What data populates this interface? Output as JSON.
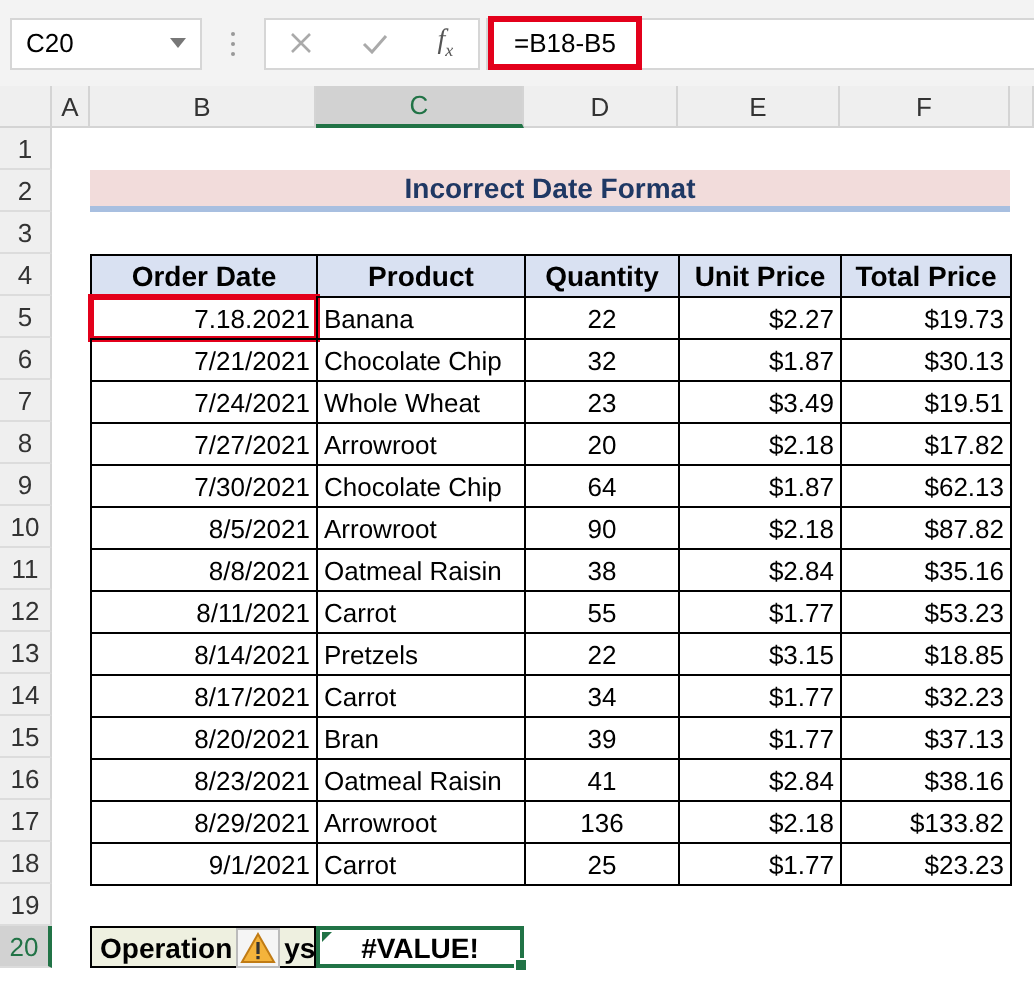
{
  "formula_bar": {
    "name_box": "C20",
    "function_button": "f$_{x}$",
    "formula": "=B18-B5",
    "formula_highlighted": true
  },
  "column_headers": [
    {
      "label": "A",
      "selected": false
    },
    {
      "label": "B",
      "selected": false
    },
    {
      "label": "C",
      "selected": true
    },
    {
      "label": "D",
      "selected": false
    },
    {
      "label": "E",
      "selected": false
    },
    {
      "label": "F",
      "selected": false
    }
  ],
  "row_headers": [
    {
      "label": "1",
      "selected": false
    },
    {
      "label": "2",
      "selected": false
    },
    {
      "label": "3",
      "selected": false
    },
    {
      "label": "4",
      "selected": false
    },
    {
      "label": "5",
      "selected": false
    },
    {
      "label": "6",
      "selected": false
    },
    {
      "label": "7",
      "selected": false
    },
    {
      "label": "8",
      "selected": false
    },
    {
      "label": "9",
      "selected": false
    },
    {
      "label": "10",
      "selected": false
    },
    {
      "label": "11",
      "selected": false
    },
    {
      "label": "12",
      "selected": false
    },
    {
      "label": "13",
      "selected": false
    },
    {
      "label": "14",
      "selected": false
    },
    {
      "label": "15",
      "selected": false
    },
    {
      "label": "16",
      "selected": false
    },
    {
      "label": "17",
      "selected": false
    },
    {
      "label": "18",
      "selected": false
    },
    {
      "label": "19",
      "selected": false
    },
    {
      "label": "20",
      "selected": true
    }
  ],
  "title": "Incorrect Date Format",
  "table": {
    "columns": [
      "Order Date",
      "Product",
      "Quantity",
      "Unit Price",
      "Total Price"
    ],
    "rows": [
      {
        "cells": [
          "7.18.2021",
          "Banana",
          "22",
          "$2.27",
          "$19.73"
        ],
        "date_highlighted": true
      },
      {
        "cells": [
          "7/21/2021",
          "Chocolate Chip",
          "32",
          "$1.87",
          "$30.13"
        ],
        "date_highlighted": false
      },
      {
        "cells": [
          "7/24/2021",
          "Whole Wheat",
          "23",
          "$3.49",
          "$19.51"
        ],
        "date_highlighted": false
      },
      {
        "cells": [
          "7/27/2021",
          "Arrowroot",
          "20",
          "$2.18",
          "$17.82"
        ],
        "date_highlighted": false
      },
      {
        "cells": [
          "7/30/2021",
          "Chocolate Chip",
          "64",
          "$1.87",
          "$62.13"
        ],
        "date_highlighted": false
      },
      {
        "cells": [
          "8/5/2021",
          "Arrowroot",
          "90",
          "$2.18",
          "$87.82"
        ],
        "date_highlighted": false
      },
      {
        "cells": [
          "8/8/2021",
          "Oatmeal Raisin",
          "38",
          "$2.84",
          "$35.16"
        ],
        "date_highlighted": false
      },
      {
        "cells": [
          "8/11/2021",
          "Carrot",
          "55",
          "$1.77",
          "$53.23"
        ],
        "date_highlighted": false
      },
      {
        "cells": [
          "8/14/2021",
          "Pretzels",
          "22",
          "$3.15",
          "$18.85"
        ],
        "date_highlighted": false
      },
      {
        "cells": [
          "8/17/2021",
          "Carrot",
          "34",
          "$1.77",
          "$32.23"
        ],
        "date_highlighted": false
      },
      {
        "cells": [
          "8/20/2021",
          "Bran",
          "39",
          "$1.77",
          "$37.13"
        ],
        "date_highlighted": false
      },
      {
        "cells": [
          "8/23/2021",
          "Oatmeal Raisin",
          "41",
          "$2.84",
          "$38.16"
        ],
        "date_highlighted": false
      },
      {
        "cells": [
          "8/29/2021",
          "Arrowroot",
          "136",
          "$2.18",
          "$133.82"
        ],
        "date_highlighted": false
      },
      {
        "cells": [
          "9/1/2021",
          "Carrot",
          "25",
          "$1.77",
          "$23.23"
        ],
        "date_highlighted": false
      }
    ]
  },
  "result": {
    "label_start": "Operation",
    "label_end": "ys",
    "value": "#VALUE!",
    "selected": true
  }
}
